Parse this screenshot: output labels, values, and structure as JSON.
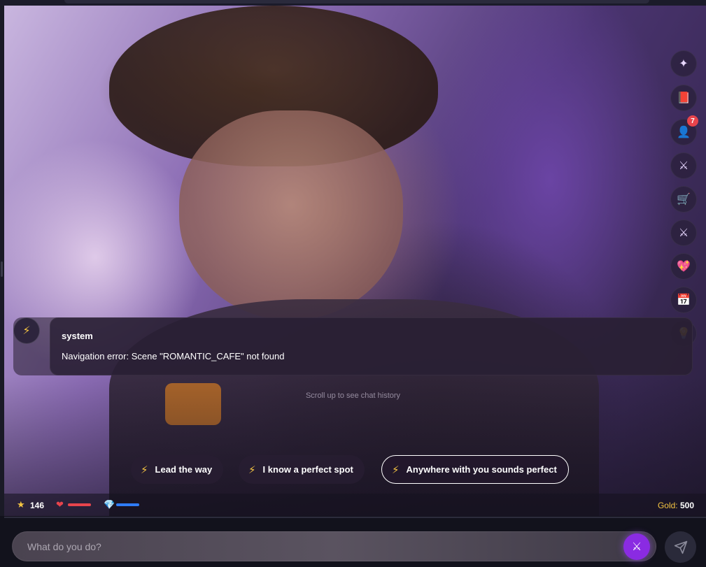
{
  "toolbar": {
    "items": [
      {
        "icon": "sparkle-icon",
        "glyph": "✦"
      },
      {
        "icon": "book-icon",
        "glyph": "📕"
      },
      {
        "icon": "character-icon",
        "glyph": "👤",
        "badge": "7"
      },
      {
        "icon": "crossed-swords-icon",
        "glyph": "⚔"
      },
      {
        "icon": "cart-icon",
        "glyph": "🛒"
      },
      {
        "icon": "battle-icon",
        "glyph": "⚔"
      },
      {
        "icon": "heart-icon",
        "glyph": "💖"
      },
      {
        "icon": "calendar-icon",
        "glyph": "📅"
      },
      {
        "icon": "lightbulb-icon",
        "glyph": "💡"
      }
    ]
  },
  "message": {
    "sender": "system",
    "text": "Navigation error: Scene \"ROMANTIC_CAFE\" not found",
    "avatar_icon": "lightning-icon",
    "avatar_glyph": "⚡"
  },
  "hint": "Scroll up to see chat history",
  "replies": [
    {
      "label": "Lead the way",
      "active": false
    },
    {
      "label": "I know a perfect spot",
      "active": false
    },
    {
      "label": "Anywhere with you sounds perfect",
      "active": true
    }
  ],
  "stats": {
    "xp": "146",
    "health_fraction": 1.0,
    "mana_fraction": 1.0,
    "gold_label": "Gold:",
    "gold_value": "500"
  },
  "composer": {
    "placeholder": "What do you do?"
  },
  "colors": {
    "accent": "#8a2be2",
    "gold": "#f5c542",
    "health": "#e8444c",
    "mana": "#2f7cf6"
  }
}
